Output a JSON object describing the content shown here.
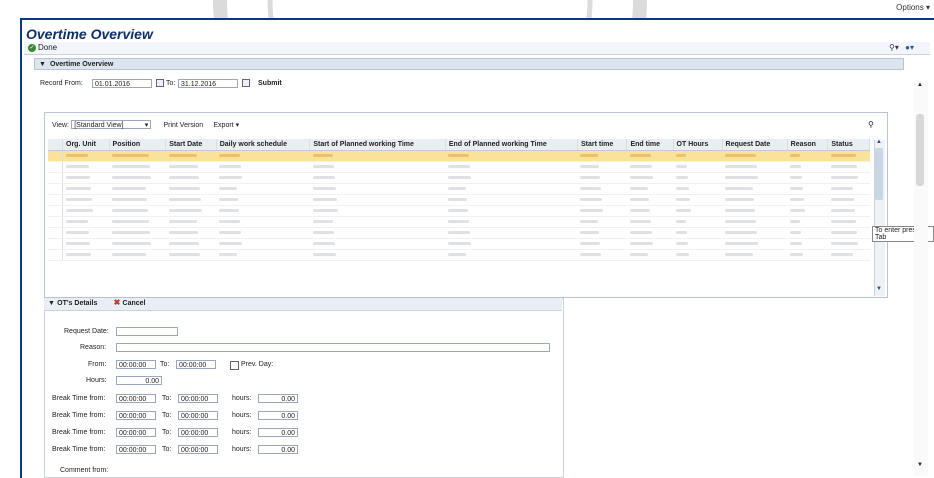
{
  "options_menu": "Options",
  "page_title": "Overtime Overview",
  "toolbar": {
    "done_label": "Done"
  },
  "section_title": "Overtime Overview",
  "filter": {
    "record_from_label": "Record From:",
    "record_from_value": "01.01.2016",
    "to_label": "To:",
    "to_value": "31.12.2016",
    "submit_label": "Submit"
  },
  "grid_toolbar": {
    "view_label": "View:",
    "view_value": "[Standard View]",
    "print_label": "Print Version",
    "export_label": "Export"
  },
  "table": {
    "columns": [
      "Org. Unit",
      "Position",
      "Start Date",
      "Daily work schedule",
      "Start of Planned working Time",
      "End of Planned working Time",
      "Start time",
      "End time",
      "OT Hours",
      "Request Date",
      "Reason",
      "Status"
    ]
  },
  "tooltip": "To enter press Tab",
  "details": {
    "title": "OT's Details",
    "cancel_label": "Cancel",
    "request_date_label": "Request Date:",
    "reason_label": "Reason:",
    "from_label": "From:",
    "from_value": "00:00:00",
    "to_label": "To:",
    "to_value": "00:00:00",
    "prev_day_label": "Prev. Day:",
    "hours_label": "Hours:",
    "hours_value": "0.00",
    "break_label": "Break Time from:",
    "break_to_label": "To:",
    "break_hours_label": "hours:",
    "break_rows": [
      {
        "from": "00:00:00",
        "to": "00:00:00",
        "hours": "0.00"
      },
      {
        "from": "00:00:00",
        "to": "00:00:00",
        "hours": "0.00"
      },
      {
        "from": "00:00:00",
        "to": "00:00:00",
        "hours": "0.00"
      },
      {
        "from": "00:00:00",
        "to": "00:00:00",
        "hours": "0.00"
      }
    ],
    "comment_label": "Comment from:"
  },
  "colors": {
    "accent": "#0e2f68",
    "selected_row": "#fae398",
    "done_green": "#3c8a2e"
  }
}
